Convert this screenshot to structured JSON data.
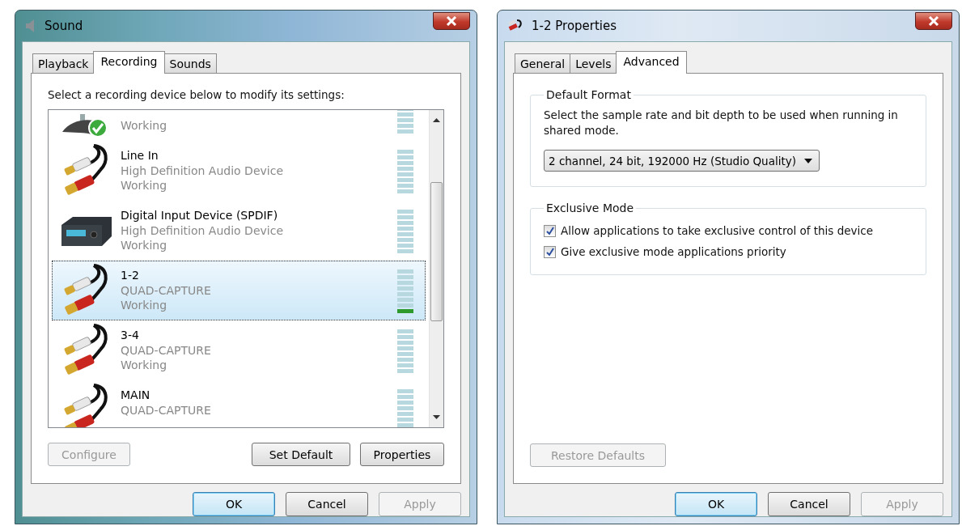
{
  "sound_window": {
    "title": "Sound",
    "tabs": [
      {
        "label": "Playback",
        "selected": false
      },
      {
        "label": "Recording",
        "selected": true
      },
      {
        "label": "Sounds",
        "selected": false
      }
    ],
    "instruction": "Select a recording device below to modify its settings:",
    "devices": [
      {
        "kind": "microphone",
        "status": "Working",
        "default": true,
        "selected": false
      },
      {
        "kind": "rca-cable",
        "name": "Line In",
        "description": "High Definition Audio Device",
        "status": "Working",
        "default": false,
        "selected": false
      },
      {
        "kind": "digital-box",
        "name": "Digital Input Device (SPDIF)",
        "description": "High Definition Audio Device",
        "status": "Working",
        "default": false,
        "selected": false
      },
      {
        "kind": "rca-cable",
        "name": "1-2",
        "description": "QUAD-CAPTURE",
        "status": "Working",
        "default": false,
        "selected": true,
        "level": 0.1
      },
      {
        "kind": "rca-cable",
        "name": "3-4",
        "description": "QUAD-CAPTURE",
        "status": "Working",
        "default": false,
        "selected": false
      },
      {
        "kind": "rca-cable",
        "name": "MAIN",
        "description": "QUAD-CAPTURE",
        "default": false,
        "selected": false
      }
    ],
    "list_buttons": [
      {
        "label": "Configure",
        "disabled": true
      },
      {
        "label": "Set Default",
        "disabled": false
      },
      {
        "label": "Properties",
        "disabled": false
      }
    ],
    "buttons": [
      {
        "label": "OK",
        "default": true,
        "disabled": false
      },
      {
        "label": "Cancel",
        "default": false,
        "disabled": false
      },
      {
        "label": "Apply",
        "default": false,
        "disabled": true
      }
    ]
  },
  "properties_window": {
    "title": "1-2 Properties",
    "tabs": [
      {
        "label": "General",
        "selected": false
      },
      {
        "label": "Levels",
        "selected": false
      },
      {
        "label": "Advanced",
        "selected": true
      }
    ],
    "default_format": {
      "heading": "Default Format",
      "description": "Select the sample rate and bit depth to be used when running in shared mode.",
      "format": "2 channel, 24 bit, 192000 Hz (Studio Quality)"
    },
    "exclusive_mode": {
      "heading": "Exclusive Mode",
      "options": [
        {
          "label": "Allow applications to take exclusive control of this device",
          "checked": true
        },
        {
          "label": "Give exclusive mode applications priority",
          "checked": true
        }
      ]
    },
    "restore_button": {
      "label": "Restore Defaults",
      "disabled": true
    },
    "buttons": [
      {
        "label": "OK",
        "default": true,
        "disabled": false
      },
      {
        "label": "Cancel",
        "default": false,
        "disabled": false
      },
      {
        "label": "Apply",
        "default": false,
        "disabled": true
      }
    ]
  }
}
